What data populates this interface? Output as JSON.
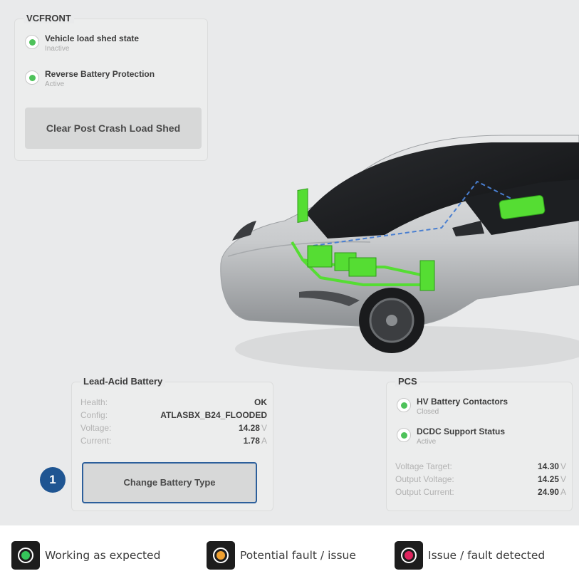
{
  "vcfront": {
    "title": "VCFRONT",
    "items": [
      {
        "label": "Vehicle load shed state",
        "status": "Inactive"
      },
      {
        "label": "Reverse Battery Protection",
        "status": "Active"
      }
    ],
    "button_label": "Clear Post Crash Load Shed"
  },
  "lead_acid": {
    "title": "Lead-Acid Battery",
    "rows": [
      {
        "key": "Health:",
        "value": "OK",
        "unit": ""
      },
      {
        "key": "Config:",
        "value": "ATLASBX_B24_FLOODED",
        "unit": ""
      },
      {
        "key": "Voltage:",
        "value": "14.28",
        "unit": "V"
      },
      {
        "key": "Current:",
        "value": "1.78",
        "unit": "A"
      }
    ],
    "button_label": "Change Battery Type",
    "callout_number": "1"
  },
  "pcs": {
    "title": "PCS",
    "items": [
      {
        "label": "HV Battery Contactors",
        "status": "Closed"
      },
      {
        "label": "DCDC Support Status",
        "status": "Active"
      }
    ],
    "rows": [
      {
        "key": "Voltage Target:",
        "value": "14.30",
        "unit": "V"
      },
      {
        "key": "Output Voltage:",
        "value": "14.25",
        "unit": "V"
      },
      {
        "key": "Output Current:",
        "value": "24.90",
        "unit": "A"
      }
    ]
  },
  "legend": [
    {
      "label": "Working as expected",
      "color": "#35c55a"
    },
    {
      "label": "Potential fault / issue",
      "color": "#f0a030"
    },
    {
      "label": "Issue / fault detected",
      "color": "#e0245e"
    }
  ],
  "colors": {
    "status_green": "#4ec25a",
    "component_green": "#55dd33",
    "accent_blue": "#1f5592"
  }
}
